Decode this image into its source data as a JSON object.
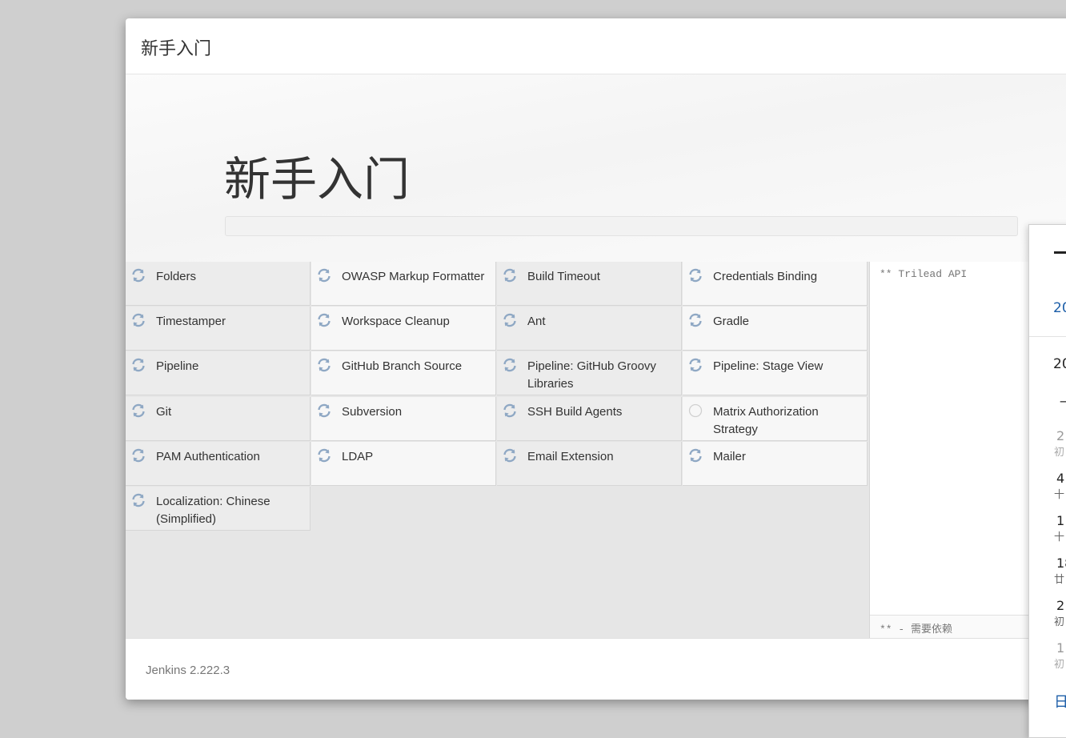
{
  "dialog": {
    "header_title": "新手入门",
    "hero_title": "新手入门",
    "progress": 0.0,
    "version": "Jenkins 2.222.3"
  },
  "plugins": [
    {
      "label": "Folders",
      "status": "installing"
    },
    {
      "label": "OWASP Markup Formatter",
      "status": "installing"
    },
    {
      "label": "Build Timeout",
      "status": "installing"
    },
    {
      "label": "Credentials Binding",
      "status": "installing"
    },
    {
      "label": "Timestamper",
      "status": "installing"
    },
    {
      "label": "Workspace Cleanup",
      "status": "installing"
    },
    {
      "label": "Ant",
      "status": "installing"
    },
    {
      "label": "Gradle",
      "status": "installing"
    },
    {
      "label": "Pipeline",
      "status": "installing"
    },
    {
      "label": "GitHub Branch Source",
      "status": "installing"
    },
    {
      "label": "Pipeline: GitHub Groovy Libraries",
      "status": "installing"
    },
    {
      "label": "Pipeline: Stage View",
      "status": "installing"
    },
    {
      "label": "Git",
      "status": "installing"
    },
    {
      "label": "Subversion",
      "status": "installing"
    },
    {
      "label": "SSH Build Agents",
      "status": "installing"
    },
    {
      "label": "Matrix Authorization Strategy",
      "status": "pending"
    },
    {
      "label": "PAM Authentication",
      "status": "installing"
    },
    {
      "label": "LDAP",
      "status": "installing"
    },
    {
      "label": "Email Extension",
      "status": "installing"
    },
    {
      "label": "Mailer",
      "status": "installing"
    },
    {
      "label": "Localization: Chinese (Simplified)",
      "status": "installing"
    }
  ],
  "log": {
    "line": "** Trilead API",
    "footer": "** - 需要依赖"
  },
  "calendar": {
    "year_link": "20",
    "month": "20",
    "weekday_header": "一",
    "rows": [
      {
        "num": "2",
        "sub": "初",
        "dim": true
      },
      {
        "num": "4",
        "sub": "十",
        "dim": false
      },
      {
        "num": "1",
        "sub": "十",
        "dim": false
      },
      {
        "num": "18",
        "sub": "廿",
        "dim": false
      },
      {
        "num": "2",
        "sub": "初",
        "dim": false
      },
      {
        "num": "1",
        "sub": "初",
        "dim": true
      }
    ],
    "bottom_link": "日"
  },
  "colors": {
    "accent": "#1c5ea8",
    "spinner": "#8fa8c4",
    "progress_fill": "#8bc34a"
  }
}
